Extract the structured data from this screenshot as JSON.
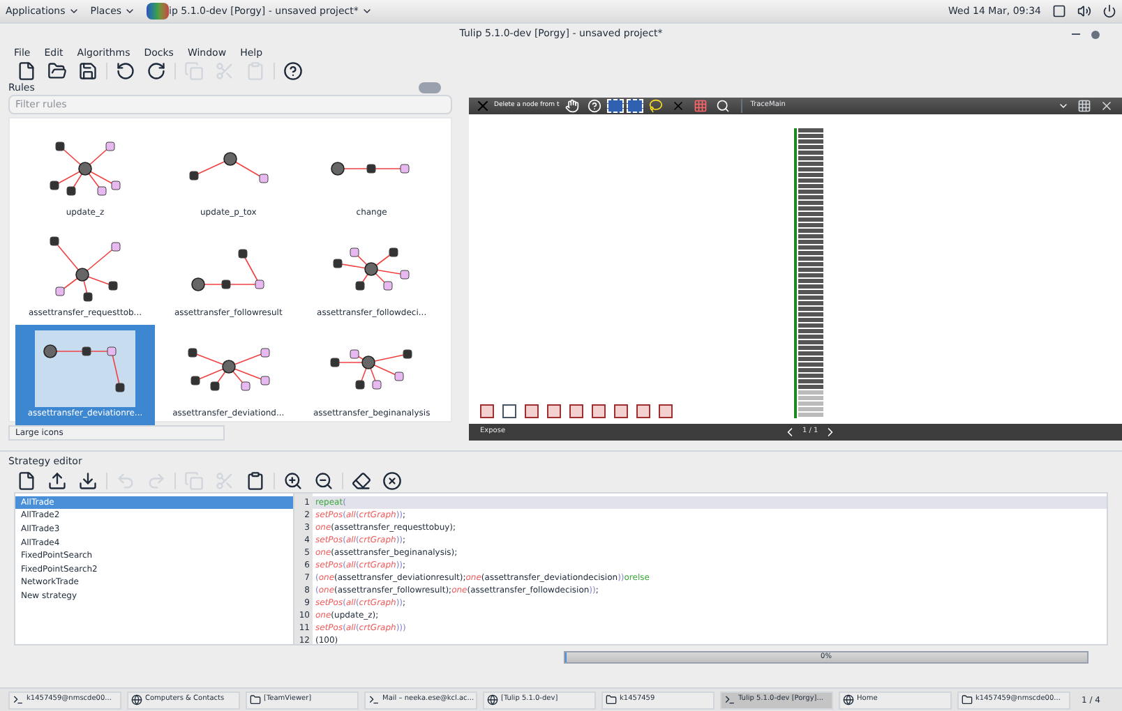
{
  "top_bar": {
    "menus": [
      "Applications",
      "Places"
    ],
    "app_title": "ip 5.1.0-dev [Porgy] - unsaved project*",
    "clock": "Wed 14 Mar, 09:34"
  },
  "window": {
    "title": "Tulip 5.1.0-dev [Porgy] - unsaved project*"
  },
  "menu_bar": [
    "File",
    "Edit",
    "Algorithms",
    "Docks",
    "Window",
    "Help"
  ],
  "rules_panel": {
    "title": "Rules",
    "filter": {
      "placeholder": "Filter rules"
    },
    "rules": [
      {
        "name": "update_z",
        "selected": false
      },
      {
        "name": "update_p_tox",
        "selected": false
      },
      {
        "name": "change",
        "selected": false
      },
      {
        "name": "assettransfer_requesttob...",
        "selected": false
      },
      {
        "name": "assettransfer_followresult",
        "selected": false
      },
      {
        "name": "assettransfer_followdeci...",
        "selected": false
      },
      {
        "name": "assettransfer_deviationre...",
        "selected": true
      },
      {
        "name": "assettransfer_deviationd...",
        "selected": false
      },
      {
        "name": "assettransfer_beginanalysis",
        "selected": false
      }
    ],
    "view_mode": "Large icons"
  },
  "graph_view": {
    "tool_label": "Delete a node from t",
    "view_name": "TraceMain",
    "footer": {
      "button": "Expose",
      "page": "1 / 1"
    }
  },
  "strategy_editor": {
    "title": "Strategy editor",
    "strategies": [
      {
        "name": "AllTrade",
        "selected": true
      },
      {
        "name": "AllTrade2",
        "selected": false
      },
      {
        "name": "AllTrade3",
        "selected": false
      },
      {
        "name": "AllTrade4",
        "selected": false
      },
      {
        "name": "FixedPointSearch",
        "selected": false
      },
      {
        "name": "FixedPointSearch2",
        "selected": false
      },
      {
        "name": "NetworkTrade",
        "selected": false
      },
      {
        "name": "New strategy",
        "selected": false
      }
    ],
    "code_lines": [
      {
        "number": "1",
        "tokens": [
          {
            "kind": "keyword",
            "text": "repeat"
          },
          {
            "kind": "bracket",
            "text": "("
          }
        ]
      },
      {
        "number": "2",
        "tokens": [
          {
            "kind": "func",
            "text": "setPos"
          },
          {
            "kind": "bracket",
            "text": "("
          },
          {
            "kind": "func",
            "text": "all"
          },
          {
            "kind": "bracket",
            "text": "("
          },
          {
            "kind": "func",
            "text": "crtGraph"
          },
          {
            "kind": "bracket",
            "text": "))"
          },
          {
            "kind": "plain",
            "text": ";"
          }
        ]
      },
      {
        "number": "3",
        "tokens": [
          {
            "kind": "func",
            "text": "one"
          },
          {
            "kind": "plain",
            "text": "(assettransfer_requesttobuy);"
          }
        ]
      },
      {
        "number": "4",
        "tokens": [
          {
            "kind": "func",
            "text": "setPos"
          },
          {
            "kind": "bracket",
            "text": "("
          },
          {
            "kind": "func",
            "text": "all"
          },
          {
            "kind": "bracket",
            "text": "("
          },
          {
            "kind": "func",
            "text": "crtGraph"
          },
          {
            "kind": "bracket",
            "text": "))"
          },
          {
            "kind": "plain",
            "text": ";"
          }
        ]
      },
      {
        "number": "5",
        "tokens": [
          {
            "kind": "func",
            "text": "one"
          },
          {
            "kind": "plain",
            "text": "(assettransfer_beginanalysis);"
          }
        ]
      },
      {
        "number": "6",
        "tokens": [
          {
            "kind": "func",
            "text": "setPos"
          },
          {
            "kind": "bracket",
            "text": "("
          },
          {
            "kind": "func",
            "text": "all"
          },
          {
            "kind": "bracket",
            "text": "("
          },
          {
            "kind": "func",
            "text": "crtGraph"
          },
          {
            "kind": "bracket",
            "text": "))"
          },
          {
            "kind": "plain",
            "text": ";"
          }
        ]
      },
      {
        "number": "7",
        "tokens": [
          {
            "kind": "bracket",
            "text": "("
          },
          {
            "kind": "func",
            "text": "one"
          },
          {
            "kind": "plain",
            "text": "(assettransfer_deviationresult);"
          },
          {
            "kind": "func",
            "text": "one"
          },
          {
            "kind": "plain",
            "text": "(assettransfer_deviationdecision"
          },
          {
            "kind": "bracket",
            "text": "))"
          },
          {
            "kind": "keyword",
            "text": "orelse"
          }
        ]
      },
      {
        "number": "8",
        "tokens": [
          {
            "kind": "bracket",
            "text": "("
          },
          {
            "kind": "func",
            "text": "one"
          },
          {
            "kind": "plain",
            "text": "(assettransfer_followresult);"
          },
          {
            "kind": "func",
            "text": "one"
          },
          {
            "kind": "plain",
            "text": "(assettransfer_followdecision"
          },
          {
            "kind": "bracket",
            "text": "))"
          },
          {
            "kind": "plain",
            "text": ";"
          }
        ]
      },
      {
        "number": "9",
        "tokens": [
          {
            "kind": "func",
            "text": "setPos"
          },
          {
            "kind": "bracket",
            "text": "("
          },
          {
            "kind": "func",
            "text": "all"
          },
          {
            "kind": "bracket",
            "text": "("
          },
          {
            "kind": "func",
            "text": "crtGraph"
          },
          {
            "kind": "bracket",
            "text": "))"
          },
          {
            "kind": "plain",
            "text": ";"
          }
        ]
      },
      {
        "number": "10",
        "tokens": [
          {
            "kind": "func",
            "text": "one"
          },
          {
            "kind": "plain",
            "text": "(update_z);"
          }
        ]
      },
      {
        "number": "11",
        "tokens": [
          {
            "kind": "func",
            "text": "setPos"
          },
          {
            "kind": "bracket",
            "text": "("
          },
          {
            "kind": "func",
            "text": "all"
          },
          {
            "kind": "bracket",
            "text": "("
          },
          {
            "kind": "func",
            "text": "crtGraph"
          },
          {
            "kind": "bracket",
            "text": ")))"
          }
        ]
      },
      {
        "number": "12",
        "tokens": [
          {
            "kind": "plain",
            "text": "(100)"
          }
        ]
      }
    ]
  },
  "progress": {
    "level": 0,
    "label": "0%"
  },
  "taskbar": {
    "items": [
      {
        "label": "k1457459@nmscde00...",
        "selected": false
      },
      {
        "label": "Computers & Contacts",
        "selected": false
      },
      {
        "label": "[TeamViewer]",
        "selected": false
      },
      {
        "label": "Mail – neeka.ese@kcl.ac...",
        "selected": false
      },
      {
        "label": "[Tulip 5.1.0-dev]",
        "selected": false
      },
      {
        "label": "k1457459",
        "selected": false
      },
      {
        "label": "Tulip 5.1.0-dev [Porgy]...",
        "selected": true
      },
      {
        "label": "Home",
        "selected": false
      },
      {
        "label": "k1457459@nmscde00...",
        "selected": false
      }
    ],
    "workspace": "1 / 4"
  }
}
